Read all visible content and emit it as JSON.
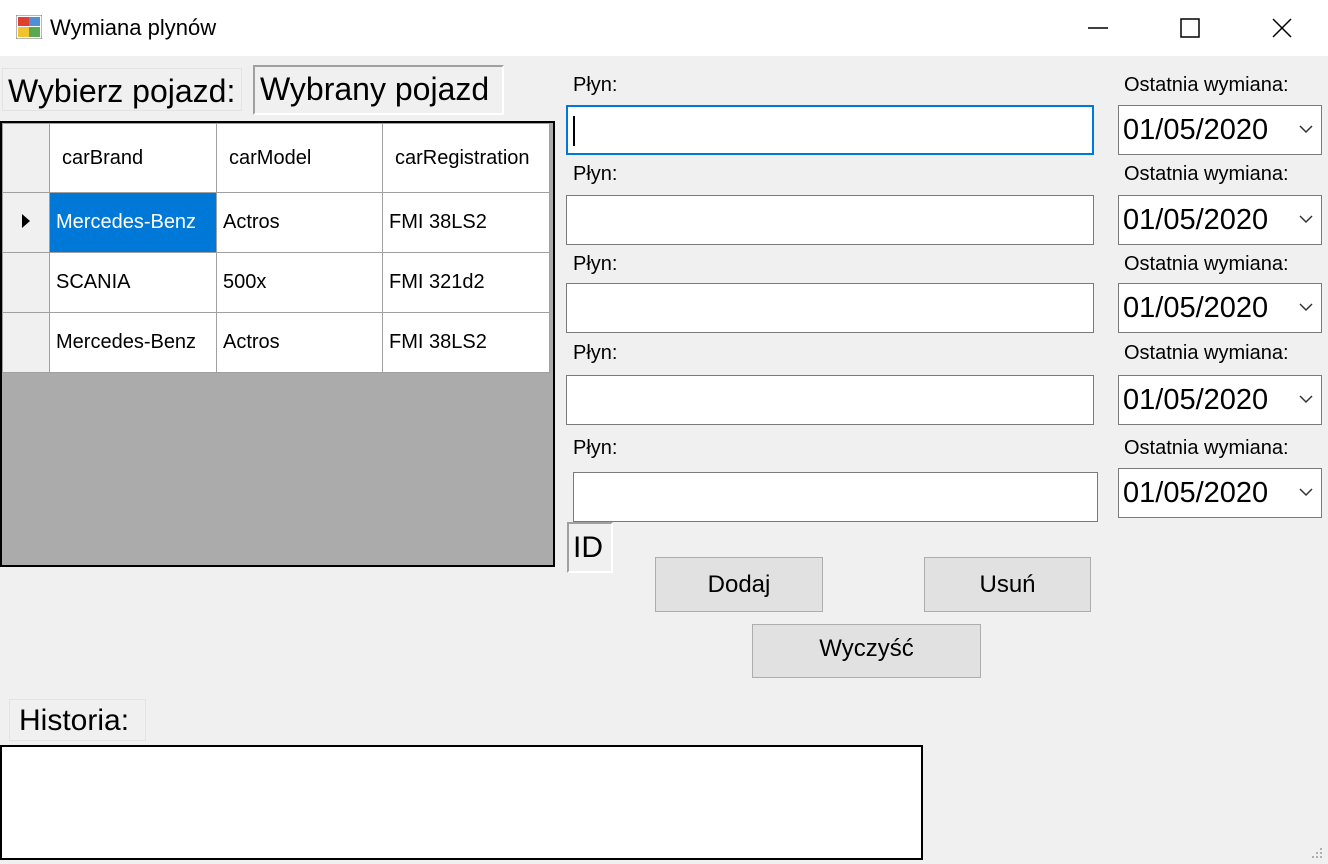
{
  "window": {
    "title": "Wymiana plynów",
    "controls": [
      "minimize-icon",
      "maximize-icon",
      "close-icon"
    ]
  },
  "labels": {
    "select_vehicle": "Wybierz pojazd:",
    "selected_vehicle": "Wybrany pojazd",
    "id": "ID",
    "history": "Historia:"
  },
  "grid": {
    "columns": [
      "carBrand",
      "carModel",
      "carRegistration"
    ],
    "rows": [
      {
        "current": true,
        "cells": [
          "Mercedes-Benz",
          "Actros",
          "FMI 38LS2"
        ]
      },
      {
        "current": false,
        "cells": [
          "SCANIA",
          "500x",
          "FMI 321d2"
        ]
      },
      {
        "current": false,
        "cells": [
          "Mercedes-Benz",
          "Actros",
          "FMI 38LS2"
        ]
      }
    ]
  },
  "fluids": [
    {
      "label": "Płyn:",
      "value": "",
      "date_label": "Ostatnia wymiana:",
      "date": "01/05/2020"
    },
    {
      "label": "Płyn:",
      "value": "",
      "date_label": "Ostatnia wymiana:",
      "date": "01/05/2020"
    },
    {
      "label": "Płyn:",
      "value": "",
      "date_label": "Ostatnia wymiana:",
      "date": "01/05/2020"
    },
    {
      "label": "Płyn:",
      "value": "",
      "date_label": "Ostatnia wymiana:",
      "date": "01/05/2020"
    },
    {
      "label": "Płyn:",
      "value": "",
      "date_label": "Ostatnia wymiana:",
      "date": "01/05/2020"
    }
  ],
  "buttons": {
    "add": "Dodaj",
    "remove": "Usuń",
    "clear": "Wyczyść"
  },
  "colors": {
    "selection": "#0078d7",
    "grid_background": "#ababab",
    "form_background": "#f0f0f0"
  }
}
